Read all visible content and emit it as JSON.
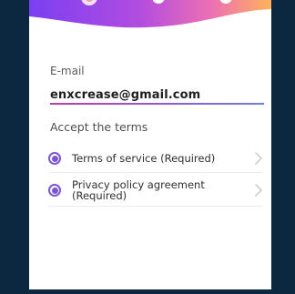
{
  "email": {
    "label": "E-mail",
    "value": "enxcrease@gmail.com"
  },
  "terms": {
    "heading": "Accept the terms",
    "items": [
      {
        "label": "Terms of service (Required)",
        "checked": true,
        "icon": "radio-selected-icon"
      },
      {
        "label_line1": "Privacy policy agreement",
        "label_line2": "(Required)",
        "checked": true,
        "icon": "radio-selected-icon"
      }
    ]
  },
  "colors": {
    "background": "#0c2740",
    "accent_purple": "#7a57d1",
    "underline_start": "#c23aa8",
    "underline_end": "#6d7ee0"
  }
}
